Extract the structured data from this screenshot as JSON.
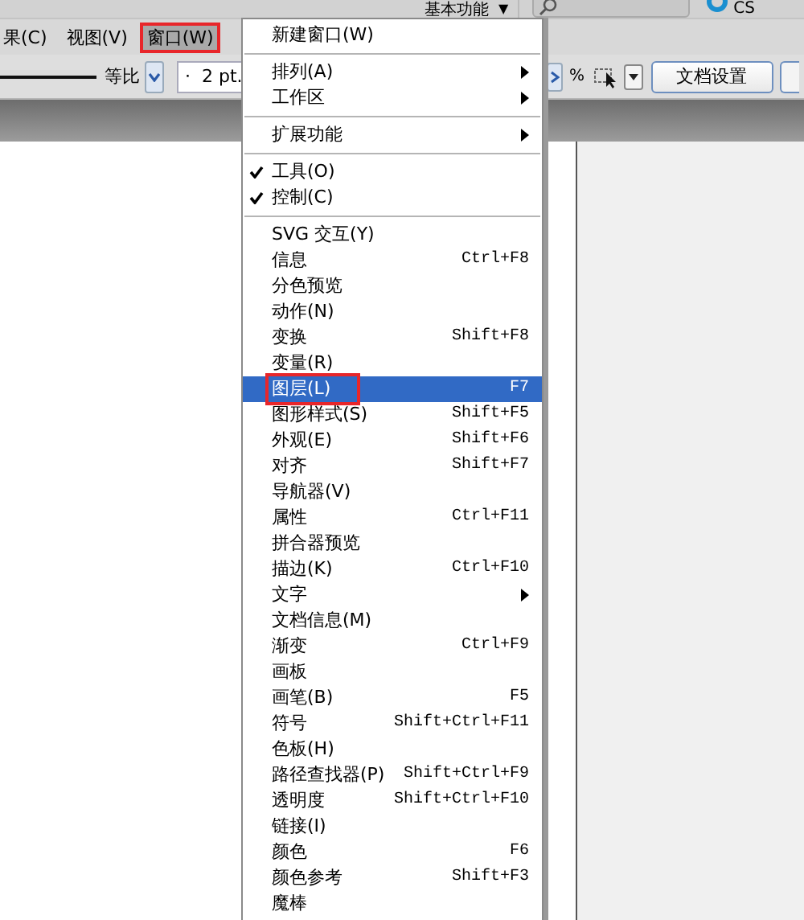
{
  "top_bar": {
    "workspace": "基本功能",
    "workspace_arrow": "▼",
    "app_label": "CS"
  },
  "menu_bar": [
    {
      "label": "果(C)",
      "selected": false,
      "highlighted": false
    },
    {
      "label": "视图(V)",
      "selected": false,
      "highlighted": false
    },
    {
      "label": "窗口(W)",
      "selected": true,
      "highlighted": true
    }
  ],
  "toolbar": {
    "ratio_label": "等比",
    "stroke_value": "·  2 pt.",
    "percent": "%",
    "doc_setup_button": "文档设置"
  },
  "menu": {
    "items": [
      {
        "kind": "item",
        "label": "新建窗口(W)",
        "checked": false,
        "submenu": false,
        "selected": false,
        "highlighted": false
      },
      {
        "kind": "separator"
      },
      {
        "kind": "item",
        "label": "排列(A)",
        "checked": false,
        "submenu": true,
        "selected": false,
        "highlighted": false
      },
      {
        "kind": "item",
        "label": "工作区",
        "checked": false,
        "submenu": true,
        "selected": false,
        "highlighted": false
      },
      {
        "kind": "separator"
      },
      {
        "kind": "item",
        "label": "扩展功能",
        "checked": false,
        "submenu": true,
        "selected": false,
        "highlighted": false
      },
      {
        "kind": "separator"
      },
      {
        "kind": "item",
        "label": "工具(O)",
        "checked": true,
        "submenu": false,
        "selected": false,
        "highlighted": false
      },
      {
        "kind": "item",
        "label": "控制(C)",
        "checked": true,
        "submenu": false,
        "selected": false,
        "highlighted": false
      },
      {
        "kind": "separator"
      },
      {
        "kind": "item",
        "label": "SVG 交互(Y)",
        "checked": false,
        "submenu": false,
        "selected": false,
        "highlighted": false
      },
      {
        "kind": "item",
        "label": "信息",
        "shortcut": "Ctrl+F8",
        "checked": false,
        "submenu": false,
        "selected": false,
        "highlighted": false
      },
      {
        "kind": "item",
        "label": "分色预览",
        "checked": false,
        "submenu": false,
        "selected": false,
        "highlighted": false
      },
      {
        "kind": "item",
        "label": "动作(N)",
        "checked": false,
        "submenu": false,
        "selected": false,
        "highlighted": false
      },
      {
        "kind": "item",
        "label": "变换",
        "shortcut": "Shift+F8",
        "checked": false,
        "submenu": false,
        "selected": false,
        "highlighted": false
      },
      {
        "kind": "item",
        "label": "变量(R)",
        "checked": false,
        "submenu": false,
        "selected": false,
        "highlighted": false
      },
      {
        "kind": "item",
        "label": "图层(L)",
        "shortcut": "F7",
        "checked": false,
        "submenu": false,
        "selected": true,
        "highlighted": true
      },
      {
        "kind": "item",
        "label": "图形样式(S)",
        "shortcut": "Shift+F5",
        "checked": false,
        "submenu": false,
        "selected": false,
        "highlighted": false
      },
      {
        "kind": "item",
        "label": "外观(E)",
        "shortcut": "Shift+F6",
        "checked": false,
        "submenu": false,
        "selected": false,
        "highlighted": false
      },
      {
        "kind": "item",
        "label": "对齐",
        "shortcut": "Shift+F7",
        "checked": false,
        "submenu": false,
        "selected": false,
        "highlighted": false
      },
      {
        "kind": "item",
        "label": "导航器(V)",
        "checked": false,
        "submenu": false,
        "selected": false,
        "highlighted": false
      },
      {
        "kind": "item",
        "label": "属性",
        "shortcut": "Ctrl+F11",
        "checked": false,
        "submenu": false,
        "selected": false,
        "highlighted": false
      },
      {
        "kind": "item",
        "label": "拼合器预览",
        "checked": false,
        "submenu": false,
        "selected": false,
        "highlighted": false
      },
      {
        "kind": "item",
        "label": "描边(K)",
        "shortcut": "Ctrl+F10",
        "checked": false,
        "submenu": false,
        "selected": false,
        "highlighted": false
      },
      {
        "kind": "item",
        "label": "文字",
        "checked": false,
        "submenu": true,
        "selected": false,
        "highlighted": false
      },
      {
        "kind": "item",
        "label": "文档信息(M)",
        "checked": false,
        "submenu": false,
        "selected": false,
        "highlighted": false
      },
      {
        "kind": "item",
        "label": "渐变",
        "shortcut": "Ctrl+F9",
        "checked": false,
        "submenu": false,
        "selected": false,
        "highlighted": false
      },
      {
        "kind": "item",
        "label": "画板",
        "checked": false,
        "submenu": false,
        "selected": false,
        "highlighted": false
      },
      {
        "kind": "item",
        "label": "画笔(B)",
        "shortcut": "F5",
        "checked": false,
        "submenu": false,
        "selected": false,
        "highlighted": false
      },
      {
        "kind": "item",
        "label": "符号",
        "shortcut": "Shift+Ctrl+F11",
        "checked": false,
        "submenu": false,
        "selected": false,
        "highlighted": false
      },
      {
        "kind": "item",
        "label": "色板(H)",
        "checked": false,
        "submenu": false,
        "selected": false,
        "highlighted": false
      },
      {
        "kind": "item",
        "label": "路径查找器(P)",
        "shortcut": "Shift+Ctrl+F9",
        "checked": false,
        "submenu": false,
        "selected": false,
        "highlighted": false
      },
      {
        "kind": "item",
        "label": "透明度",
        "shortcut": "Shift+Ctrl+F10",
        "checked": false,
        "submenu": false,
        "selected": false,
        "highlighted": false
      },
      {
        "kind": "item",
        "label": "链接(I)",
        "checked": false,
        "submenu": false,
        "selected": false,
        "highlighted": false
      },
      {
        "kind": "item",
        "label": "颜色",
        "shortcut": "F6",
        "checked": false,
        "submenu": false,
        "selected": false,
        "highlighted": false
      },
      {
        "kind": "item",
        "label": "颜色参考",
        "shortcut": "Shift+F3",
        "checked": false,
        "submenu": false,
        "selected": false,
        "highlighted": false
      },
      {
        "kind": "item",
        "label": "魔棒",
        "checked": false,
        "submenu": false,
        "selected": false,
        "highlighted": false
      }
    ]
  }
}
